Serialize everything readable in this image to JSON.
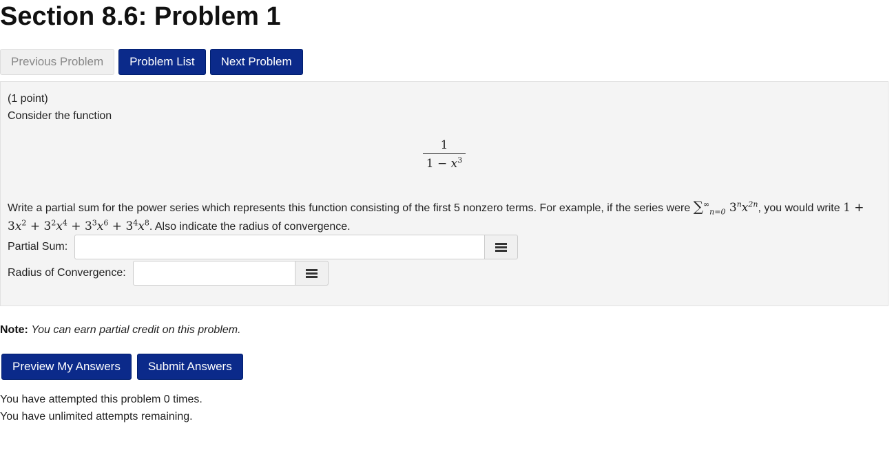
{
  "page": {
    "title": "Section 8.6: Problem 1"
  },
  "nav": {
    "previous_label": "Previous Problem",
    "list_label": "Problem List",
    "next_label": "Next Problem"
  },
  "problem": {
    "points": "(1 point)",
    "intro": "Consider the function",
    "fraction": {
      "numerator": "1",
      "denominator_const": "1 − ",
      "denominator_var": "x",
      "denominator_exp": "3"
    },
    "text_part1": "Write a partial sum for the power series which represents this function consisting of the first 5 nonzero terms. For example, if the series were ",
    "example_series": {
      "sigma": "∑",
      "upper": "∞",
      "lower": "n=0",
      "term_base": "3",
      "term_exp": "n",
      "term_var": "x",
      "term_var_exp": "2n"
    },
    "text_part2": ", you would write ",
    "example_sum": {
      "t1": "1 + 3",
      "t2_exp": "2",
      "plus": " + ",
      "b2": "3",
      "b2_exp": "2",
      "x2_exp": "4",
      "b3": "3",
      "b3_exp": "3",
      "x3_exp": "6",
      "b4": "3",
      "b4_exp": "4",
      "x4_exp": "8",
      "var": "x"
    },
    "text_part3": ". Also indicate the radius of convergence.",
    "partial_sum_label": "Partial Sum:",
    "partial_sum_value": "",
    "radius_label": "Radius of Convergence:",
    "radius_value": ""
  },
  "note": {
    "label": "Note:",
    "text": "You can earn partial credit on this problem."
  },
  "actions": {
    "preview_label": "Preview My Answers",
    "submit_label": "Submit Answers"
  },
  "status": {
    "attempted": "You have attempted this problem 0 times.",
    "remaining": "You have unlimited attempts remaining."
  },
  "colors": {
    "primary_button": "#0b2a8a",
    "problem_background": "#f4f4f4"
  },
  "icons": {
    "equation_editor": "grid-icon"
  }
}
